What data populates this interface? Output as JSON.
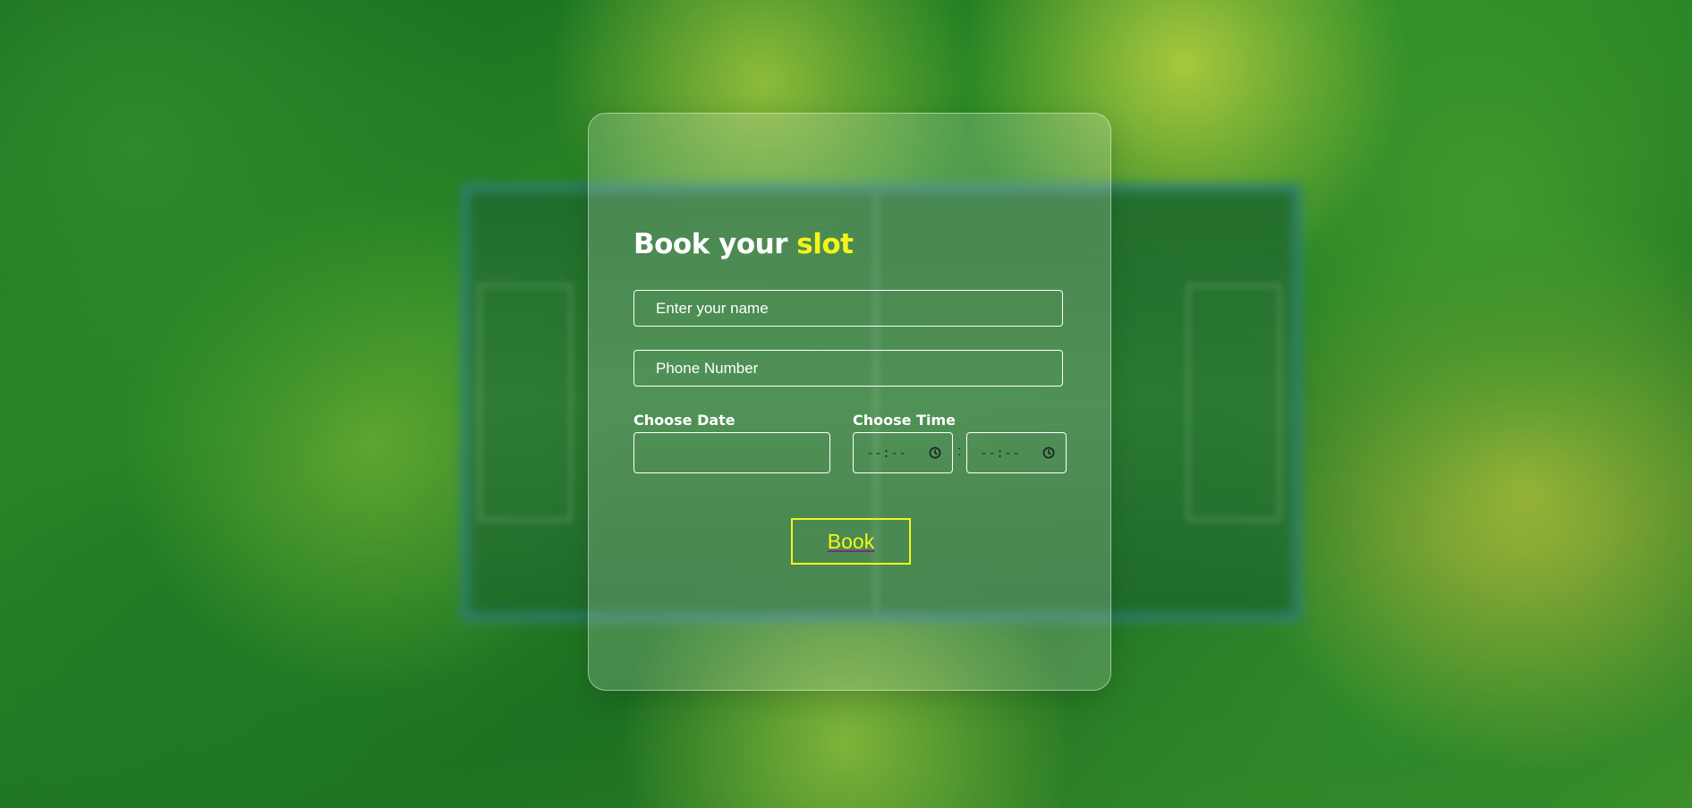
{
  "form": {
    "title_main": "Book your",
    "title_accent": "slot",
    "name_placeholder": "Enter your name",
    "phone_placeholder": "Phone Number",
    "date_label": "Choose Date",
    "time_label": "Choose Time",
    "time_start_value": "--:--",
    "time_end_value": "--:--",
    "time_separator": ":",
    "book_label": "Book"
  },
  "colors": {
    "accent": "#f5f51a",
    "text": "#ffffff",
    "background": "#2a8a26"
  },
  "icons": {
    "time_picker": "clock-icon"
  }
}
